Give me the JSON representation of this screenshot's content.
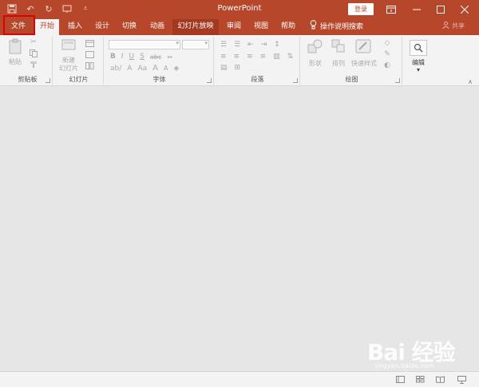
{
  "colors": {
    "accent": "#b7472a",
    "accent_dark": "#a33a20",
    "highlight_box": "#e00000",
    "ribbon_bg": "#f3f3f3",
    "workspace_bg": "#e6e6e6"
  },
  "titlebar": {
    "app_title": "PowerPoint",
    "login_label": "登录",
    "qat_icons": [
      "save-icon",
      "undo-icon",
      "redo-icon",
      "start-from-beginning-icon",
      "customize-qat-icon"
    ]
  },
  "tabs": [
    {
      "label": "文件",
      "state": "normal"
    },
    {
      "label": "开始",
      "state": "active"
    },
    {
      "label": "插入",
      "state": "normal"
    },
    {
      "label": "设计",
      "state": "normal"
    },
    {
      "label": "切换",
      "state": "normal"
    },
    {
      "label": "动画",
      "state": "normal"
    },
    {
      "label": "幻灯片放映",
      "state": "highlighted"
    },
    {
      "label": "审阅",
      "state": "normal"
    },
    {
      "label": "视图",
      "state": "normal"
    },
    {
      "label": "帮助",
      "state": "normal"
    }
  ],
  "tell_me": {
    "label": "操作说明搜索",
    "icon": "lightbulb-icon"
  },
  "share": {
    "label": "共享",
    "icon": "person-icon"
  },
  "ribbon": {
    "clipboard": {
      "label": "剪贴板",
      "paste_label": "粘贴"
    },
    "slides": {
      "label": "幻灯片",
      "new_slide_line1": "新建",
      "new_slide_line2": "幻灯片"
    },
    "font": {
      "label": "字体",
      "bold": "B",
      "italic": "I",
      "underline": "U",
      "strike": "S",
      "spacing": "abc",
      "case": "Aa",
      "grow": "A",
      "shrink": "A"
    },
    "paragraph": {
      "label": "段落"
    },
    "drawing": {
      "label": "绘图",
      "shapes_label": "形状",
      "arrange_label": "排列",
      "quick_styles_label": "快速样式"
    },
    "editing": {
      "label": "编辑"
    }
  },
  "watermark": {
    "text": "Bai 经验",
    "sub": "jingyan.baidu.com"
  }
}
